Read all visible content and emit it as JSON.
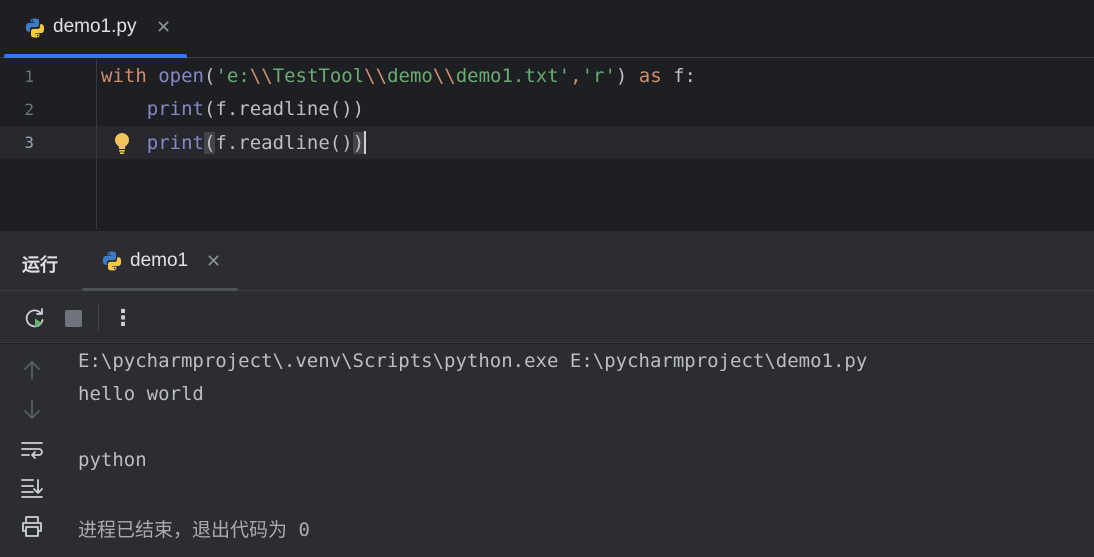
{
  "editor_tab": {
    "label": "demo1.py",
    "close": "✕"
  },
  "editor": {
    "line_numbers": [
      "1",
      "2",
      "3"
    ],
    "lines": [
      {
        "tokens": [
          {
            "t": "with",
            "c": "kw"
          },
          {
            "t": " ",
            "c": "pl"
          },
          {
            "t": "open",
            "c": "fn"
          },
          {
            "t": "(",
            "c": "pl"
          },
          {
            "t": "'e:",
            "c": "str"
          },
          {
            "t": "\\\\",
            "c": "esc"
          },
          {
            "t": "TestTool",
            "c": "str"
          },
          {
            "t": "\\\\",
            "c": "esc"
          },
          {
            "t": "demo",
            "c": "str"
          },
          {
            "t": "\\\\",
            "c": "esc"
          },
          {
            "t": "demo1.txt'",
            "c": "str"
          },
          {
            "t": ",",
            "c": "kw"
          },
          {
            "t": "'r'",
            "c": "str"
          },
          {
            "t": ") ",
            "c": "pl"
          },
          {
            "t": "as",
            "c": "kw"
          },
          {
            "t": " f:",
            "c": "pl"
          }
        ]
      },
      {
        "tokens": [
          {
            "t": "    ",
            "c": "pl"
          },
          {
            "t": "print",
            "c": "fn"
          },
          {
            "t": "(f.readline())",
            "c": "pl"
          }
        ]
      },
      {
        "tokens": [
          {
            "t": "    ",
            "c": "pl"
          },
          {
            "t": "print",
            "c": "fn"
          },
          {
            "t": "(",
            "c": "pl bracket"
          },
          {
            "t": "f.readline()",
            "c": "pl"
          },
          {
            "t": ")",
            "c": "pl bracket"
          }
        ]
      }
    ]
  },
  "run_panel": {
    "title": "运行",
    "tab_label": "demo1",
    "close": "✕",
    "toolbar": {
      "rerun": "rerun-icon",
      "stop": "stop-icon",
      "more": "⋮"
    },
    "console_lines": [
      "E:\\pycharmproject\\.venv\\Scripts\\python.exe E:\\pycharmproject\\demo1.py",
      "hello world",
      "",
      "python",
      "",
      "进程已结束，退出代码为 0"
    ]
  },
  "colors": {
    "accent": "#3574f0",
    "keyword": "#cf8e6d",
    "builtin": "#8888c6",
    "string": "#6aab73",
    "bulb": "#f2c55c"
  }
}
